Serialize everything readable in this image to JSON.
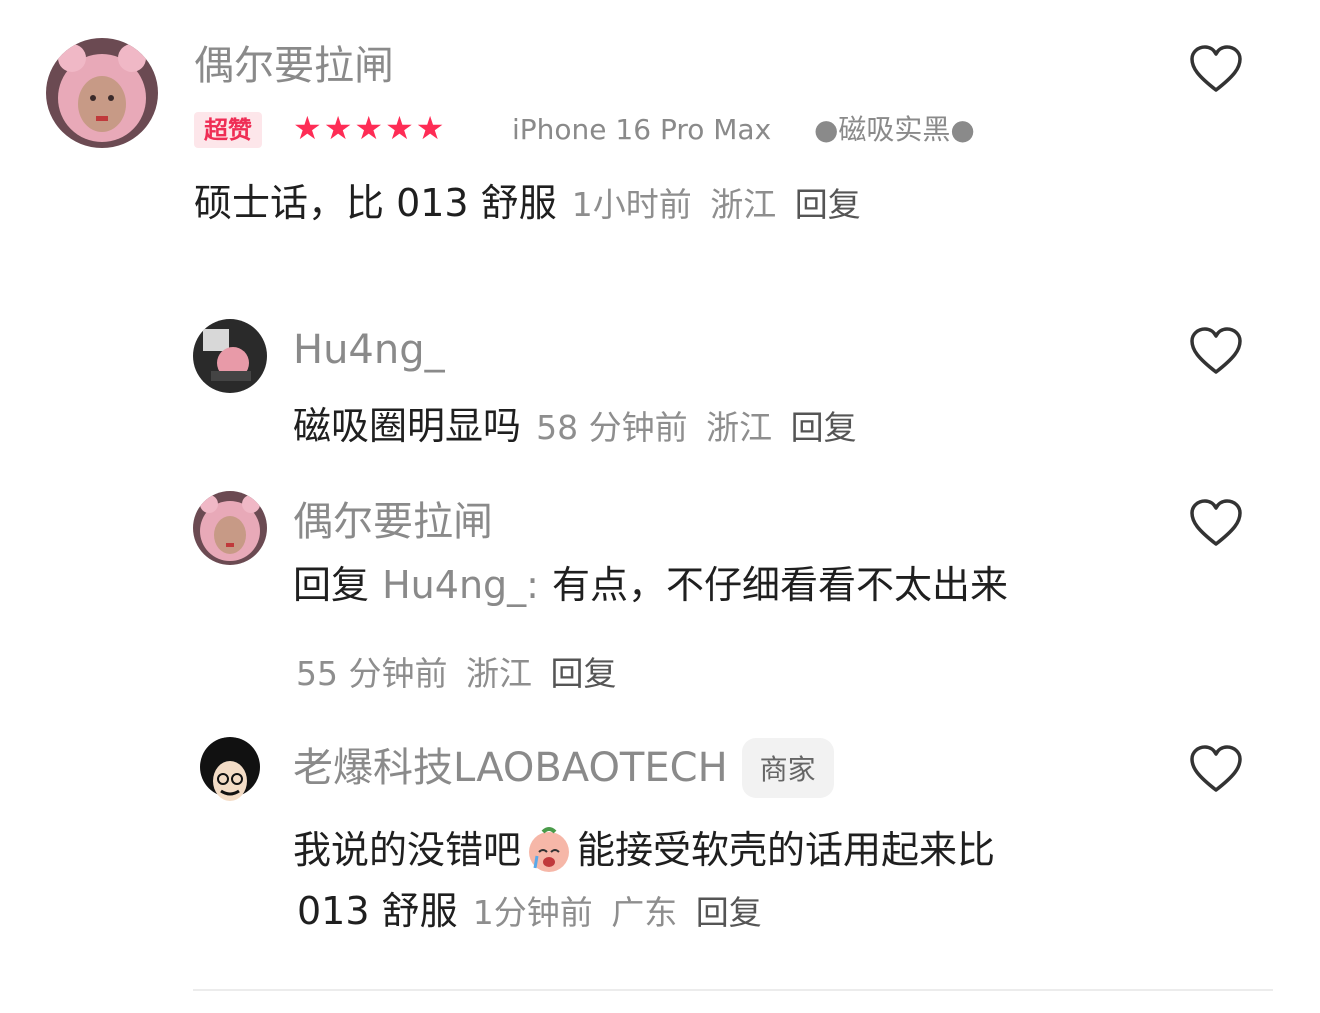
{
  "comments": [
    {
      "username": "偶尔要拉闸",
      "badge": "超赞",
      "stars": "★★★★★",
      "rating": 5,
      "device": "iPhone 16 Pro Max",
      "variant": "●磁吸实黑●",
      "text": "硕士话，比 013 舒服",
      "time": "1小时前",
      "location": "浙江",
      "reply_label": "回复"
    }
  ],
  "replies": [
    {
      "username": "Hu4ng_",
      "text": "磁吸圈明显吗",
      "time": "58 分钟前",
      "location": "浙江",
      "reply_label": "回复"
    },
    {
      "username": "偶尔要拉闸",
      "reply_prefix": "回复",
      "reply_to": "Hu4ng_:",
      "text": "有点，不仔细看看不太出来",
      "time": "55 分钟前",
      "location": "浙江",
      "reply_label": "回复"
    },
    {
      "username": "老爆科技LAOBAOTECH",
      "merchant_badge": "商家",
      "text_line1": "我说的没错吧",
      "emoji": "crying-face-emoji",
      "text_line1_after": "能接受软壳的话用起来比",
      "text_line2": "013 舒服",
      "time": "1分钟前",
      "location": "广东",
      "reply_label": "回复"
    }
  ],
  "colors": {
    "accent": "#fe2c55",
    "name_gray": "#8a8a8a",
    "text": "#1f1f1f"
  }
}
